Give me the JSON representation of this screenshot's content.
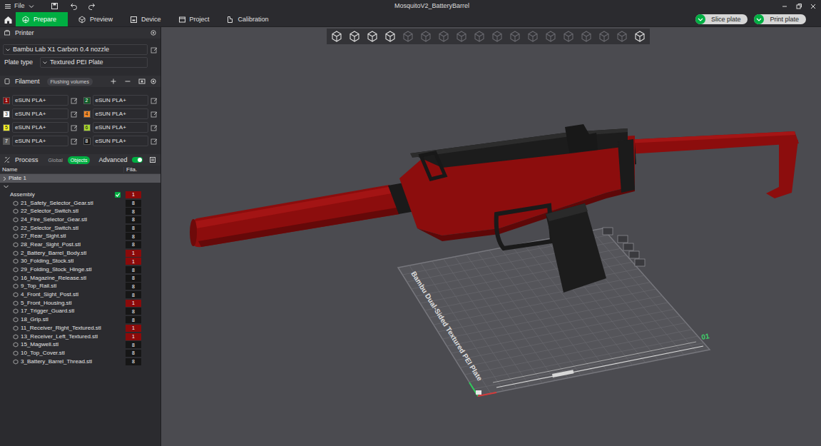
{
  "window": {
    "menu": "File",
    "title": "MosquitoV2_BatteryBarrel"
  },
  "tabs": [
    {
      "label": "Prepare",
      "selected": true
    },
    {
      "label": "Preview",
      "selected": false
    },
    {
      "label": "Device",
      "selected": false
    },
    {
      "label": "Project",
      "selected": false
    },
    {
      "label": "Calibration",
      "selected": false
    }
  ],
  "actions": [
    {
      "label": "Slice plate"
    },
    {
      "label": "Print plate"
    }
  ],
  "printer": {
    "section": "Printer",
    "preset": "Bambu Lab X1 Carbon 0.4 nozzle",
    "plate_type_label": "Plate type",
    "plate_type": "Textured PEI Plate"
  },
  "filament": {
    "section": "Filament",
    "flushing": "Flushing volumes",
    "items": [
      {
        "index": "1",
        "name": "eSUN PLA+",
        "color": "#8b0a0a"
      },
      {
        "index": "2",
        "name": "eSUN PLA+",
        "color": "#0e5a26"
      },
      {
        "index": "3",
        "name": "eSUN PLA+",
        "color": "#ffffff"
      },
      {
        "index": "4",
        "name": "eSUN PLA+",
        "color": "#f0892a"
      },
      {
        "index": "5",
        "name": "eSUN PLA+",
        "color": "#f2ef2a"
      },
      {
        "index": "6",
        "name": "eSUN PLA+",
        "color": "#a8d82e"
      },
      {
        "index": "7",
        "name": "eSUN PLA+",
        "color": "#5a5a5a"
      },
      {
        "index": "8",
        "name": "eSUN PLA+",
        "color": "#161616"
      }
    ]
  },
  "process": {
    "section": "Process",
    "modes": [
      {
        "label": "Global",
        "selected": false
      },
      {
        "label": "Objects",
        "selected": true
      }
    ],
    "advanced": {
      "label": "Advanced",
      "on": true
    }
  },
  "objects": {
    "columns": [
      "Name",
      "Fila."
    ],
    "plate": {
      "label": "Plate 1",
      "selected": true,
      "expanded": false
    },
    "assembly": {
      "name": "Assembly",
      "expanded": true,
      "printable": true,
      "filament": "1",
      "color": "#8b0a0a"
    },
    "parts": [
      {
        "name": "21_Safety_Selector_Gear.stl",
        "filament": "8",
        "color": "#161616"
      },
      {
        "name": "22_Selector_Switch.stl",
        "filament": "8",
        "color": "#161616"
      },
      {
        "name": "24_Fire_Selector_Gear.stl",
        "filament": "8",
        "color": "#161616"
      },
      {
        "name": "22_Selector_Switch.stl",
        "filament": "8",
        "color": "#161616"
      },
      {
        "name": "27_Rear_Sight.stl",
        "filament": "8",
        "color": "#161616"
      },
      {
        "name": "28_Rear_Sight_Post.stl",
        "filament": "8",
        "color": "#161616"
      },
      {
        "name": "2_Battery_Barrel_Body.stl",
        "filament": "1",
        "color": "#8b0a0a"
      },
      {
        "name": "30_Folding_Stock.stl",
        "filament": "1",
        "color": "#8b0a0a"
      },
      {
        "name": "29_Folding_Stock_Hinge.stl",
        "filament": "8",
        "color": "#161616"
      },
      {
        "name": "16_Magazine_Release.stl",
        "filament": "8",
        "color": "#161616"
      },
      {
        "name": "9_Top_Rail.stl",
        "filament": "8",
        "color": "#161616"
      },
      {
        "name": "4_Front_Sight_Post.stl",
        "filament": "8",
        "color": "#161616"
      },
      {
        "name": "5_Front_Housing.stl",
        "filament": "1",
        "color": "#8b0a0a"
      },
      {
        "name": "17_Trigger_Guard.stl",
        "filament": "8",
        "color": "#161616"
      },
      {
        "name": "18_Grip.stl",
        "filament": "8",
        "color": "#161616"
      },
      {
        "name": "11_Receiver_Right_Textured.stl",
        "filament": "1",
        "color": "#8b0a0a"
      },
      {
        "name": "13_Receiver_Left_Textured.stl",
        "filament": "1",
        "color": "#8b0a0a"
      },
      {
        "name": "15_Magwell.stl",
        "filament": "8",
        "color": "#161616"
      },
      {
        "name": "10_Top_Cover.stl",
        "filament": "8",
        "color": "#161616"
      },
      {
        "name": "3_Battery_Barrel_Thread.stl",
        "filament": "8",
        "color": "#161616"
      }
    ]
  },
  "viewport": {
    "plate_label": "Bambu Dual-Sided Textured PEI Plate",
    "plate_number": "01",
    "tools": [
      {
        "disabled": false
      },
      {
        "disabled": false
      },
      {
        "disabled": false
      },
      {
        "disabled": false
      },
      {
        "disabled": true
      },
      {
        "disabled": true
      },
      {
        "disabled": true
      },
      {
        "disabled": true
      },
      {
        "disabled": true
      },
      {
        "disabled": true
      },
      {
        "disabled": true
      },
      {
        "disabled": true
      },
      {
        "disabled": true
      },
      {
        "disabled": true
      },
      {
        "disabled": true
      },
      {
        "disabled": true
      },
      {
        "disabled": true
      },
      {
        "disabled": false
      }
    ]
  }
}
